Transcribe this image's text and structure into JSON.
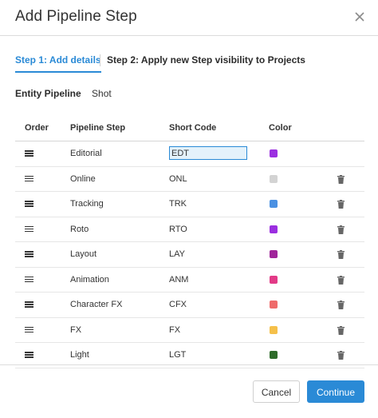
{
  "dialog": {
    "title": "Add Pipeline Step"
  },
  "steps": {
    "step1": "Step 1: Add details",
    "step2": "Step 2: Apply new Step visibility to Projects"
  },
  "entity": {
    "label": "Entity Pipeline",
    "value": "Shot"
  },
  "table": {
    "headers": {
      "order": "Order",
      "name": "Pipeline Step",
      "code": "Short Code",
      "color": "Color"
    },
    "rows": [
      {
        "name": "Editorial",
        "code": "EDT",
        "color": "#9b2fe0",
        "editing": true,
        "deletable": false
      },
      {
        "name": "Online",
        "code": "ONL",
        "color": "#d3d3d3",
        "editing": false,
        "deletable": true
      },
      {
        "name": "Tracking",
        "code": "TRK",
        "color": "#4a90e2",
        "editing": false,
        "deletable": true
      },
      {
        "name": "Roto",
        "code": "RTO",
        "color": "#9b2fe0",
        "editing": false,
        "deletable": true
      },
      {
        "name": "Layout",
        "code": "LAY",
        "color": "#a0259a",
        "editing": false,
        "deletable": true
      },
      {
        "name": "Animation",
        "code": "ANM",
        "color": "#e23a87",
        "editing": false,
        "deletable": true
      },
      {
        "name": "Character FX",
        "code": "CFX",
        "color": "#ef6b6b",
        "editing": false,
        "deletable": true
      },
      {
        "name": "FX",
        "code": "FX",
        "color": "#f5c04a",
        "editing": false,
        "deletable": true
      },
      {
        "name": "Light",
        "code": "LGT",
        "color": "#2e6b2a",
        "editing": false,
        "deletable": true
      }
    ]
  },
  "footer": {
    "cancel": "Cancel",
    "continue": "Continue"
  }
}
